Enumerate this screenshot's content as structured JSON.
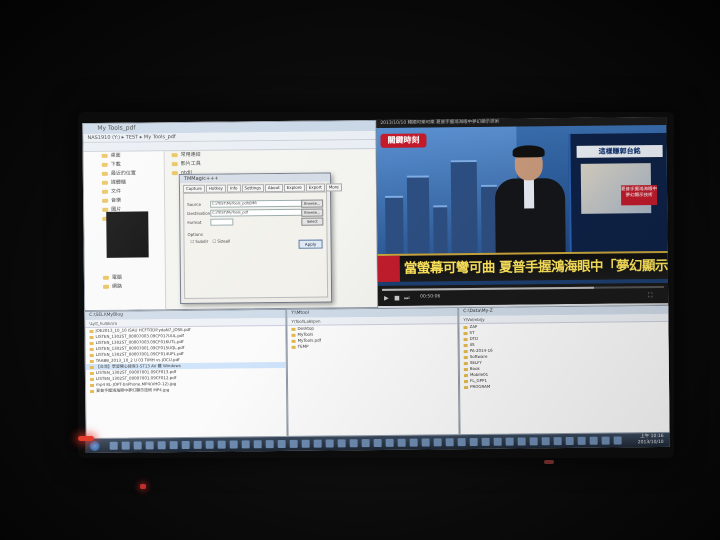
{
  "explorer": {
    "title": "My Tools_pdf",
    "address": "NAS1910 (Y:) ▸ TEST ▸ My Tools_pdf",
    "nav_items": [
      "桌面",
      "下載",
      "最近的位置",
      "媒體櫃",
      "文件",
      "音樂",
      "圖片",
      "視訊",
      "電腦",
      "網路"
    ],
    "files": [
      "常用連結",
      "影片工具",
      "ntdll"
    ]
  },
  "dialog": {
    "title": "TMMagic+++",
    "tabs": [
      "Capture",
      "Hotkey",
      "Info",
      "Settings",
      "About",
      "Explore",
      "Export",
      "More"
    ],
    "source_label": "Source",
    "source_value": "C:\\TEST\\MyTools_pdf\\EMR",
    "dest_label": "Destination",
    "dest_value": "C:\\TEST\\MyTools_pdf",
    "format_label": "Format",
    "options_label": "Options",
    "check1": "Subdir",
    "check2": "Sizeall",
    "browse": "Browse...",
    "select": "Select",
    "apply": "Apply"
  },
  "player": {
    "title": "2013/10/10 韓國可樂可樂 夏普手握鴻海眼中夢幻顯示技術",
    "logo": "關鍵時刻",
    "panel_head": "這樣賺郭台銘",
    "panel_sub": "夏普手握鴻海眼中夢幻顯示技術",
    "ticker": "當螢幕可彎可曲 夏普手握鴻海眼中「夢幻顯示技術」!",
    "time": "00:50:06"
  },
  "pane1": {
    "title": "C:\\SELI\\MyBlog",
    "path": "\\Ly\\t_hu\\Bu\\ra",
    "rows": [
      "JOE2013_10_10 ISAU HCFTODP.ydaN7_JOSE.pdf",
      "LISTEN_1302ST_00007003.09CF017UUL.pdf",
      "LISTEN_1302ST_00007003.09CF016UTL.pdf",
      "LISTEN_1302ST_00007001.09CF015UQL.pdf",
      "LISTEN_1302ST_00007001.09CF014UPL.pdf",
      "TAABB_2013_10_2 U 03 TIMH vs JOCU.pdf",
      "【台灣】學習開心錄音3-ST13 AV 體 Windows",
      "LISTEN_1302ST_00007001.09CF013.pdf",
      "LISTEN_1302ST_00007001.09CF012.pdf",
      "mp4 8L-JOPT-bnPhone.MP4(VHO-12).jpg",
      "夏普手握鴻海眼中夢幻顯示技術 MP4.jpg"
    ]
  },
  "pane2": {
    "title": "Y:\\Mtool",
    "path": "Y\\Tool\\LaB\\pvn",
    "rows": [
      "Desktop",
      "MyTools",
      "MyTools.pdf",
      "TEMP"
    ]
  },
  "pane3": {
    "title": "C:\\Data\\My-Z",
    "path": "Y\\Vo\\mb\\jy",
    "rows": [
      "ZAP",
      "ST",
      "DTD",
      "IIS",
      "PA-2014-16",
      "Software",
      "SELFY",
      "Book",
      "Mobile01",
      "FL_GPP1",
      "PROGRAM"
    ]
  },
  "taskbar": {
    "time": "上午 10:16",
    "date": "2013/10/10"
  }
}
